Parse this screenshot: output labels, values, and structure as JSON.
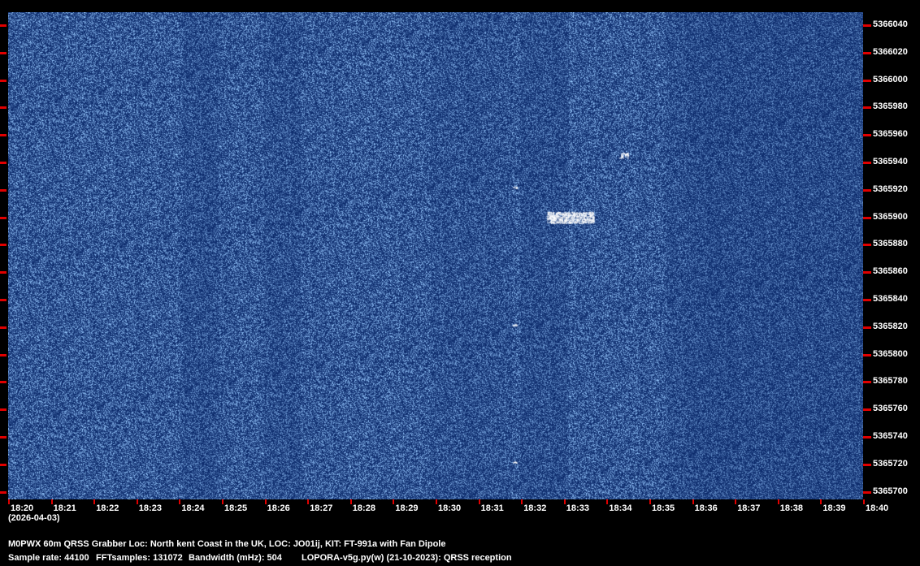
{
  "chart_data": {
    "type": "heatmap",
    "title": "M0PWX 60m QRSS Grabber Loc: North kent Coast in the UK, LOC: JO01ij, KIT: FT-991a with Fan Dipole",
    "xlabel": "(2026-04-03)",
    "ylabel": "",
    "x_ticks": [
      "18:20",
      "18:21",
      "18:22",
      "18:23",
      "18:24",
      "18:25",
      "18:26",
      "18:27",
      "18:28",
      "18:29",
      "18:30",
      "18:31",
      "18:32",
      "18:33",
      "18:34",
      "18:35",
      "18:36",
      "18:37",
      "18:38",
      "18:39",
      "18:40"
    ],
    "y_ticks": [
      "5366040",
      "5366020",
      "5366000",
      "5365980",
      "5365960",
      "5365940",
      "5365920",
      "5365900",
      "5365880",
      "5365860",
      "5365840",
      "5365820",
      "5365800",
      "5365780",
      "5365760",
      "5365740",
      "5365720",
      "5365700"
    ],
    "xlim_minutes": [
      0,
      20
    ],
    "ylim_hz": [
      5365695,
      5366049
    ],
    "signals": [
      {
        "t_start_min": 12.6,
        "t_end_min": 13.7,
        "freq_hz": 5365900,
        "strength": 1.0
      },
      {
        "t_start_min": 14.3,
        "t_end_min": 14.5,
        "freq_hz": 5365945,
        "strength": 0.9
      },
      {
        "t_start_min": 11.8,
        "t_end_min": 11.9,
        "freq_hz": 5365922,
        "strength": 0.6
      },
      {
        "t_start_min": 11.8,
        "t_end_min": 11.9,
        "freq_hz": 5365822,
        "strength": 0.6
      },
      {
        "t_start_min": 11.8,
        "t_end_min": 11.9,
        "freq_hz": 5365722,
        "strength": 0.6
      }
    ],
    "colors": {
      "background": "#0d2a6b",
      "signal": "#ffffff",
      "tick": "#e00000"
    }
  },
  "footer": {
    "date": "(2026-04-03)",
    "station": "M0PWX 60m QRSS Grabber Loc: North kent Coast in the UK, LOC: JO01ij, KIT: FT-991a with Fan Dipole",
    "sample_rate": "Sample rate: 44100",
    "fft_samples": "FFTsamples: 131072",
    "bandwidth": "Bandwidth (mHz): 504",
    "software": "LOPORA-v5g.py(w) (21-10-2023): QRSS reception"
  }
}
